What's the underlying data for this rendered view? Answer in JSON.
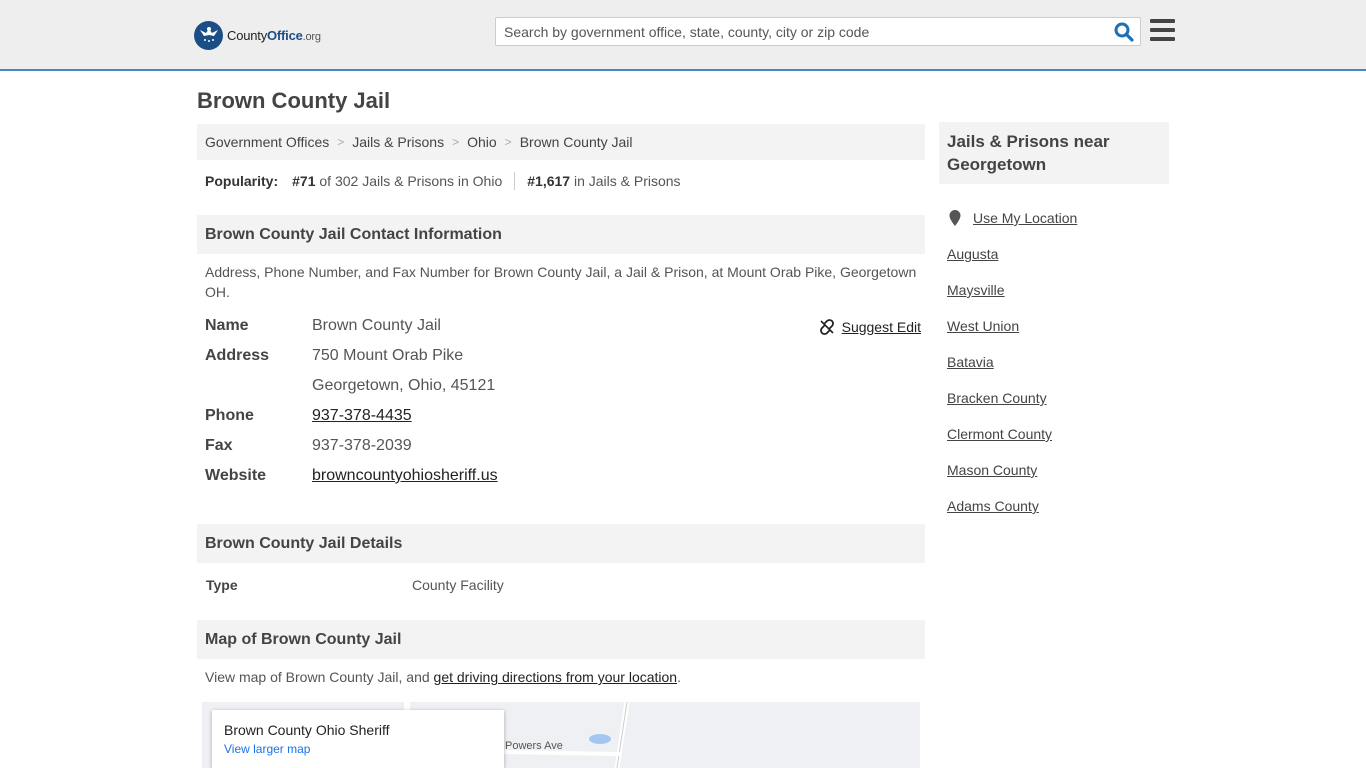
{
  "header": {
    "logo": {
      "part1": "County",
      "part2": "Office",
      "part3": ".org"
    },
    "search": {
      "placeholder": "Search by government office, state, county, city or zip code"
    }
  },
  "page": {
    "title": "Brown County Jail",
    "breadcrumb": [
      "Government Offices",
      "Jails & Prisons",
      "Ohio",
      "Brown County Jail"
    ],
    "popularity": {
      "label": "Popularity:",
      "rank_state": "#71",
      "rank_state_text": "of 302 Jails & Prisons in Ohio",
      "rank_national": "#1,617",
      "rank_national_text": "in Jails & Prisons"
    }
  },
  "contact": {
    "heading": "Brown County Jail Contact Information",
    "description": "Address, Phone Number, and Fax Number for Brown County Jail, a Jail & Prison, at Mount Orab Pike, Georgetown OH.",
    "suggest_edit": "Suggest Edit",
    "rows": {
      "name_label": "Name",
      "name_value": "Brown County Jail",
      "address_label": "Address",
      "address_line1": "750 Mount Orab Pike",
      "address_line2": "Georgetown, Ohio, 45121",
      "phone_label": "Phone",
      "phone_value": "937-378-4435",
      "fax_label": "Fax",
      "fax_value": "937-378-2039",
      "website_label": "Website",
      "website_value": "browncountyohiosheriff.us"
    }
  },
  "details": {
    "heading": "Brown County Jail Details",
    "type_label": "Type",
    "type_value": "County Facility"
  },
  "map": {
    "heading": "Map of Brown County Jail",
    "desc_prefix": "View map of Brown County Jail, and ",
    "desc_link": "get driving directions from your location",
    "desc_suffix": ".",
    "card_title": "Brown County Ohio Sheriff",
    "card_link": "View larger map",
    "street_label": "Powers Ave"
  },
  "sidebar": {
    "heading": "Jails & Prisons near Georgetown",
    "use_location": "Use My Location",
    "items": [
      "Augusta",
      "Maysville",
      "West Union",
      "Batavia",
      "Bracken County",
      "Clermont County",
      "Mason County",
      "Adams County"
    ]
  },
  "colors": {
    "accent": "#4a86c5",
    "logo_blue": "#1c4e86",
    "search_icon": "#1f6fb8"
  }
}
